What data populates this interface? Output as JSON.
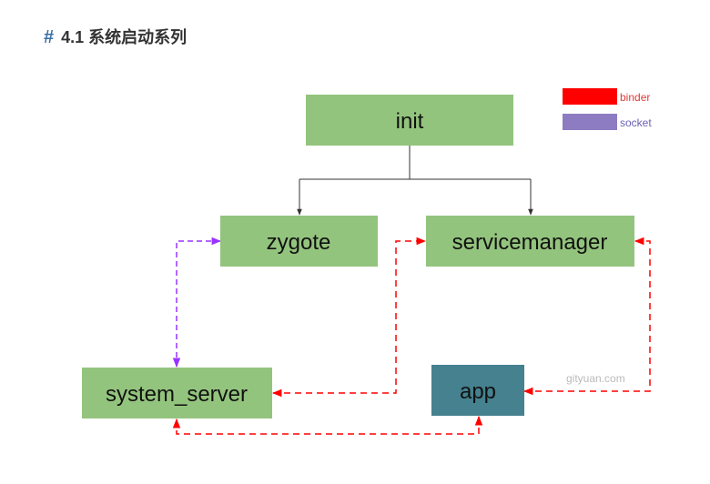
{
  "heading": {
    "hash": "#",
    "text": "4.1 系统启动系列"
  },
  "legend": [
    {
      "label": "binder",
      "color": "#ff0000",
      "text_color": "#e53935"
    },
    {
      "label": "socket",
      "color": "#8e7cc3",
      "text_color": "#6a5fb3"
    }
  ],
  "nodes": {
    "init": "init",
    "zygote": "zygote",
    "servicemanager": "servicemanager",
    "system_server": "system_server",
    "app": "app"
  },
  "colors": {
    "node_green": "#93c47d",
    "node_teal": "#45818e",
    "tree_line": "#333333",
    "binder": "#ff0000",
    "socket": "#9933ff"
  },
  "watermark": "gityuan.com"
}
